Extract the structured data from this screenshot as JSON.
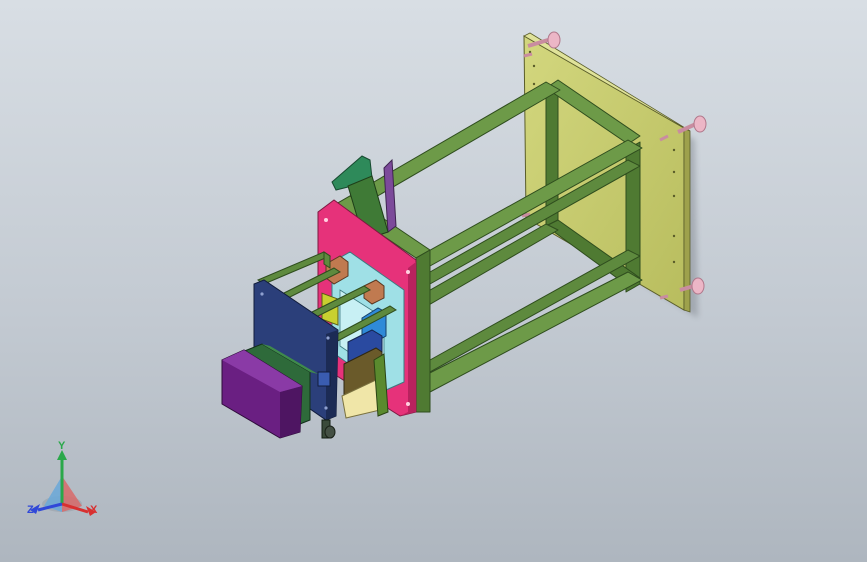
{
  "viewport": {
    "background_top": "#d8dee4",
    "background_bottom": "#aeb6bf"
  },
  "model": {
    "frame_color": "#5c8a3c",
    "mount_plate_color": "#c9cf72",
    "flange_color": "#e6327a",
    "panel_color": "#2b3f7a",
    "motor_color": "#6a1f82",
    "standoff_color": "#ecb6c6"
  },
  "triad": {
    "x_label": "X",
    "y_label": "Y",
    "z_label": "Z",
    "x_color": "#d83030",
    "y_color": "#2aa84a",
    "z_color": "#3048d8"
  }
}
